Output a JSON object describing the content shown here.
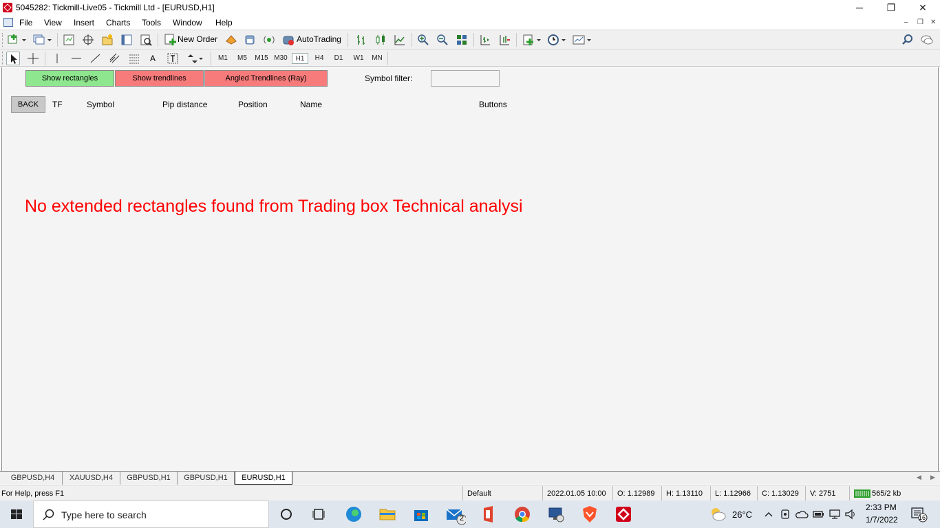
{
  "window": {
    "title": "5045282: Tickmill-Live05 - Tickmill Ltd - [EURUSD,H1]",
    "controls": {
      "minimize": "─",
      "restore": "❐",
      "close": "✕"
    }
  },
  "menu": {
    "items": [
      "File",
      "View",
      "Insert",
      "Charts",
      "Tools",
      "Window",
      "Help"
    ],
    "mdi_controls": {
      "minimize": "–",
      "restore": "❐",
      "close": "✕"
    }
  },
  "toolbar": {
    "new_order": "New Order",
    "autotrading": "AutoTrading",
    "text_tool": "A",
    "timeframes": [
      "M1",
      "M5",
      "M15",
      "M30",
      "H1",
      "H4",
      "D1",
      "W1",
      "MN"
    ],
    "active_timeframe": "H1"
  },
  "panel": {
    "show_rectangles": "Show rectangles",
    "show_trendlines": "Show trendlines",
    "angled_trendlines": "Angled Trendlines (Ray)",
    "symbol_filter_label": "Symbol filter:",
    "symbol_filter_value": "",
    "back": "BACK",
    "columns": [
      "TF",
      "Symbol",
      "Pip distance",
      "Position",
      "Name",
      "Buttons"
    ],
    "message": "No extended rectangles found from Trading box Technical analysi",
    "colors": {
      "green_button": "#8ee68e",
      "red_button": "#f77b7b",
      "message": "#ff0000"
    }
  },
  "chart_tabs": {
    "tabs": [
      "GBPUSD,H4",
      "XAUUSD,H4",
      "GBPUSD,H1",
      "GBPUSD,H1",
      "EURUSD,H1"
    ],
    "active": "EURUSD,H1",
    "arrows": {
      "left": "◀",
      "right": "▶"
    }
  },
  "status": {
    "help": "For Help, press F1",
    "profile": "Default",
    "datetime": "2022.01.05 10:00",
    "open": "O: 1.12989",
    "high": "H: 1.13110",
    "low": "L: 1.12966",
    "close": "C: 1.13029",
    "volume": "V: 2751",
    "traffic": "565/2 kb"
  },
  "taskbar": {
    "search_placeholder": "Type here to search",
    "mail_badge": "2",
    "weather": "26°C",
    "time": "2:33 PM",
    "date": "1/7/2022",
    "notifications": "16"
  }
}
